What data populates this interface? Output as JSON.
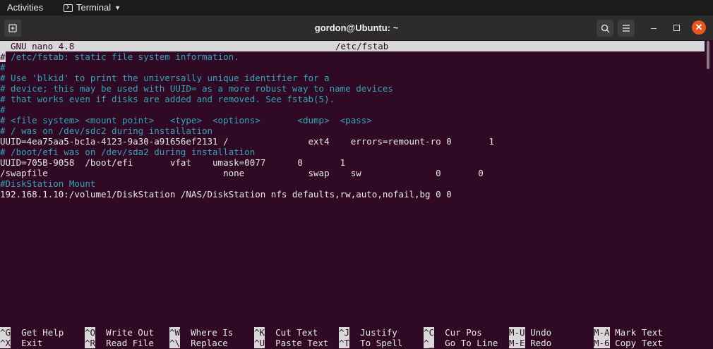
{
  "topbar": {
    "activities": "Activities",
    "app_name": "Terminal"
  },
  "window": {
    "title": "gordon@Ubuntu: ~"
  },
  "nano": {
    "version": "GNU nano 4.8",
    "filename": "/etc/fstab",
    "lines": [
      {
        "text": "# /etc/fstab: static file system information.",
        "style": "comment-cursor"
      },
      {
        "text": "#",
        "style": "comment"
      },
      {
        "text": "# Use 'blkid' to print the universally unique identifier for a",
        "style": "comment"
      },
      {
        "text": "# device; this may be used with UUID= as a more robust way to name devices",
        "style": "comment"
      },
      {
        "text": "# that works even if disks are added and removed. See fstab(5).",
        "style": "comment"
      },
      {
        "text": "#",
        "style": "comment"
      },
      {
        "text": "# <file system> <mount point>   <type>  <options>       <dump>  <pass>",
        "style": "comment"
      },
      {
        "text": "# / was on /dev/sdc2 during installation",
        "style": "comment"
      },
      {
        "text": "UUID=4ea75aa5-bc1a-4123-9a30-a91656ef2131 /               ext4    errors=remount-ro 0       1",
        "style": "normal"
      },
      {
        "text": "# /boot/efi was on /dev/sda2 during installation",
        "style": "comment"
      },
      {
        "text": "UUID=705B-9058  /boot/efi       vfat    umask=0077      0       1",
        "style": "normal"
      },
      {
        "text": "/swapfile                                 none            swap    sw              0       0",
        "style": "normal"
      },
      {
        "text": "#DiskStation Mount",
        "style": "comment"
      },
      {
        "text": "192.168.1.10:/volume1/DiskStation /NAS/DiskStation nfs defaults,rw,auto,nofail,bg 0 0",
        "style": "normal"
      }
    ]
  },
  "shortcuts": [
    {
      "key": "^G",
      "label": "Get Help"
    },
    {
      "key": "^O",
      "label": "Write Out"
    },
    {
      "key": "^W",
      "label": "Where Is"
    },
    {
      "key": "^K",
      "label": "Cut Text"
    },
    {
      "key": "^J",
      "label": "Justify"
    },
    {
      "key": "^C",
      "label": "Cur Pos"
    },
    {
      "key": "M-U",
      "label": "Undo"
    },
    {
      "key": "M-A",
      "label": "Mark Text"
    },
    {
      "key": "^X",
      "label": "Exit"
    },
    {
      "key": "^R",
      "label": "Read File"
    },
    {
      "key": "^\\",
      "label": "Replace"
    },
    {
      "key": "^U",
      "label": "Paste Text"
    },
    {
      "key": "^T",
      "label": "To Spell"
    },
    {
      "key": "^_",
      "label": "Go To Line"
    },
    {
      "key": "M-E",
      "label": "Redo"
    },
    {
      "key": "M-6",
      "label": "Copy Text"
    }
  ],
  "icons": {
    "new_tab": "new-tab-icon",
    "search": "search-icon",
    "menu": "hamburger-menu-icon",
    "minimize": "minimize-icon",
    "maximize": "maximize-icon",
    "close": "close-icon"
  },
  "colors": {
    "terminal_bg": "#300a24",
    "comment": "#36a3b8",
    "close_button": "#e95420",
    "highlight": "#d8d8d8"
  }
}
